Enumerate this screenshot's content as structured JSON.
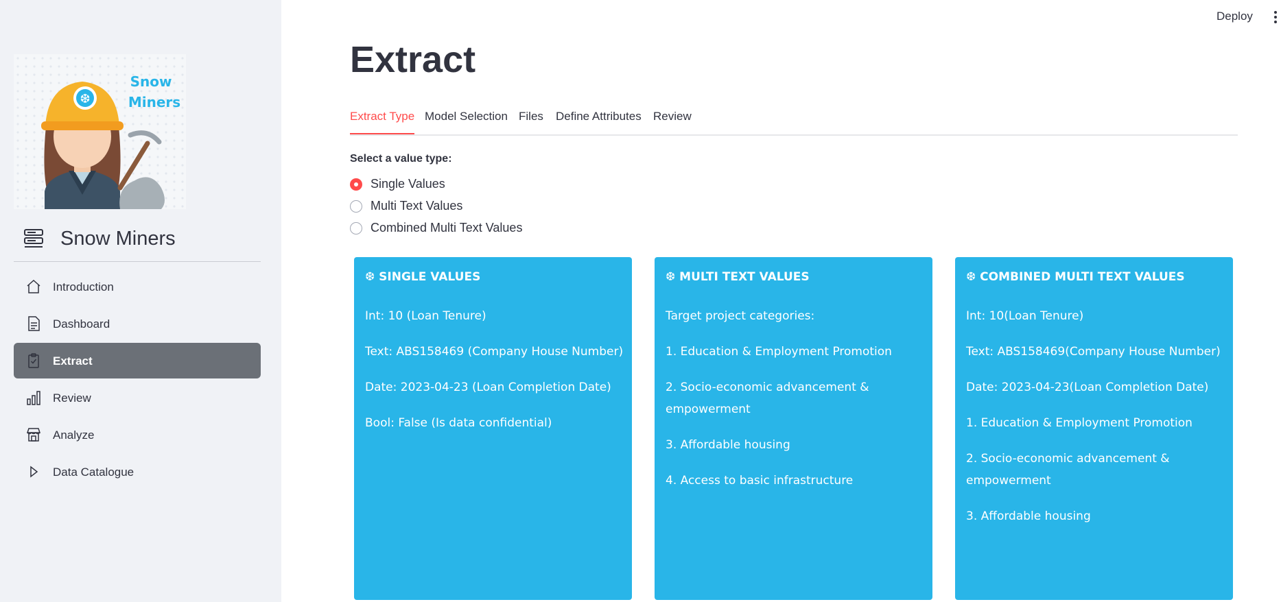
{
  "topbar": {
    "deploy_label": "Deploy"
  },
  "sidebar": {
    "brand_title": "Snow Miners",
    "logo_text": [
      "Snow",
      "Miners"
    ],
    "items": [
      {
        "label": "Introduction",
        "icon": "home-icon",
        "active": false
      },
      {
        "label": "Dashboard",
        "icon": "document-icon",
        "active": false
      },
      {
        "label": "Extract",
        "icon": "clipboard-check-icon",
        "active": true
      },
      {
        "label": "Review",
        "icon": "bar-chart-icon",
        "active": false
      },
      {
        "label": "Analyze",
        "icon": "shop-icon",
        "active": false
      },
      {
        "label": "Data Catalogue",
        "icon": "play-icon",
        "active": false
      }
    ]
  },
  "main": {
    "title": "Extract",
    "tabs": [
      {
        "label": "Extract Type",
        "active": true
      },
      {
        "label": "Model Selection",
        "active": false
      },
      {
        "label": "Files",
        "active": false
      },
      {
        "label": "Define Attributes",
        "active": false
      },
      {
        "label": "Review",
        "active": false
      }
    ],
    "radio_group": {
      "label": "Select a value type:",
      "options": [
        "Single Values",
        "Multi Text Values",
        "Combined Multi Text Values"
      ],
      "selected": "Single Values"
    },
    "cards": [
      {
        "title": "❆ SINGLE VALUES",
        "lines": [
          "Int: 10 (Loan Tenure)",
          "Text: ABS158469 (Company House Number)",
          "Date: 2023-04-23 (Loan Completion Date)",
          "Bool: False (Is data confidential)"
        ]
      },
      {
        "title": "❆ MULTI TEXT VALUES",
        "lines": [
          "Target project categories:",
          "1. Education & Employment Promotion",
          "2. Socio-economic advancement & empowerment",
          "3. Affordable housing",
          "4. Access to basic infrastructure"
        ]
      },
      {
        "title": "❆ COMBINED MULTI TEXT VALUES",
        "lines": [
          "Int: 10(Loan Tenure)",
          "Text: ABS158469(Company House Number)",
          "Date: 2023-04-23(Loan Completion Date)",
          "1. Education & Employment Promotion",
          "2. Socio-economic advancement & empowerment",
          "3. Affordable housing"
        ]
      }
    ]
  },
  "colors": {
    "accent": "#ff4b4b",
    "card_bg": "#29b5e8",
    "sidebar_bg": "#f0f2f6",
    "active_nav_bg": "#6b7077"
  }
}
